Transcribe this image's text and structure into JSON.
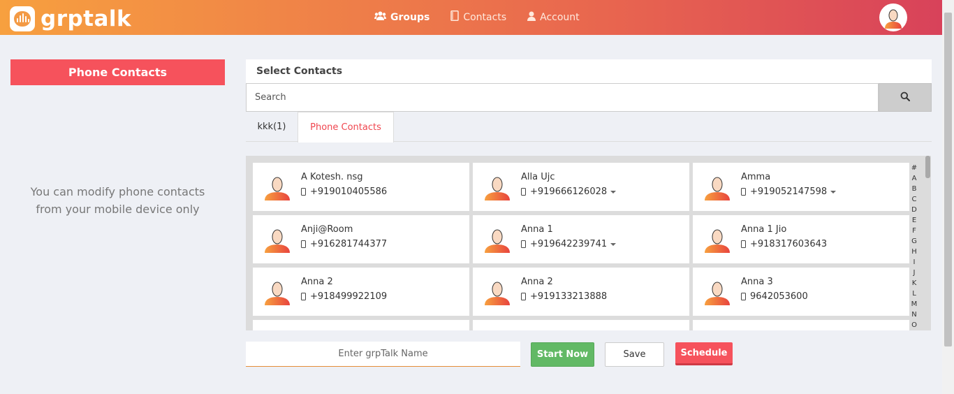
{
  "header": {
    "logo_text": "grptalk",
    "nav": [
      {
        "label": "Groups",
        "icon": "users-icon"
      },
      {
        "label": "Contacts",
        "icon": "contacts-icon"
      },
      {
        "label": "Account",
        "icon": "user-icon"
      }
    ],
    "colors": {
      "gradient_start": "#f7a03f",
      "gradient_end": "#d8425a"
    }
  },
  "left_panel": {
    "title": "Phone Contacts",
    "note_line1": "You can modify phone contacts",
    "note_line2": "from your mobile device only",
    "accent": "#f6525c"
  },
  "select_contacts": {
    "heading": "Select Contacts",
    "search_placeholder": "Search",
    "tabs": [
      {
        "label": "kkk(1)",
        "active": false
      },
      {
        "label": "Phone Contacts",
        "active": true
      }
    ]
  },
  "contacts": [
    {
      "name": "A Kotesh. nsg",
      "phone": "+919010405586",
      "dropdown": false
    },
    {
      "name": "Alla Ujc",
      "phone": "+919666126028",
      "dropdown": true
    },
    {
      "name": "Amma",
      "phone": "+919052147598",
      "dropdown": true
    },
    {
      "name": "Anji@Room",
      "phone": "+916281744377",
      "dropdown": false
    },
    {
      "name": "Anna 1",
      "phone": "+919642239741",
      "dropdown": true
    },
    {
      "name": "Anna 1 Jio",
      "phone": "+918317603643",
      "dropdown": false
    },
    {
      "name": "Anna 2",
      "phone": "+918499922109",
      "dropdown": false
    },
    {
      "name": "Anna 2",
      "phone": "+919133213888",
      "dropdown": false
    },
    {
      "name": "Anna 3",
      "phone": "9642053600",
      "dropdown": false
    }
  ],
  "alphabet": [
    "#",
    "A",
    "B",
    "C",
    "D",
    "E",
    "F",
    "G",
    "H",
    "I",
    "J",
    "K",
    "L",
    "M",
    "N",
    "O"
  ],
  "footer": {
    "name_placeholder": "Enter grpTalk Name",
    "start_label": "Start Now",
    "save_label": "Save",
    "schedule_label": "Schedule",
    "start_color": "#62b965",
    "schedule_color": "#f6525c"
  }
}
